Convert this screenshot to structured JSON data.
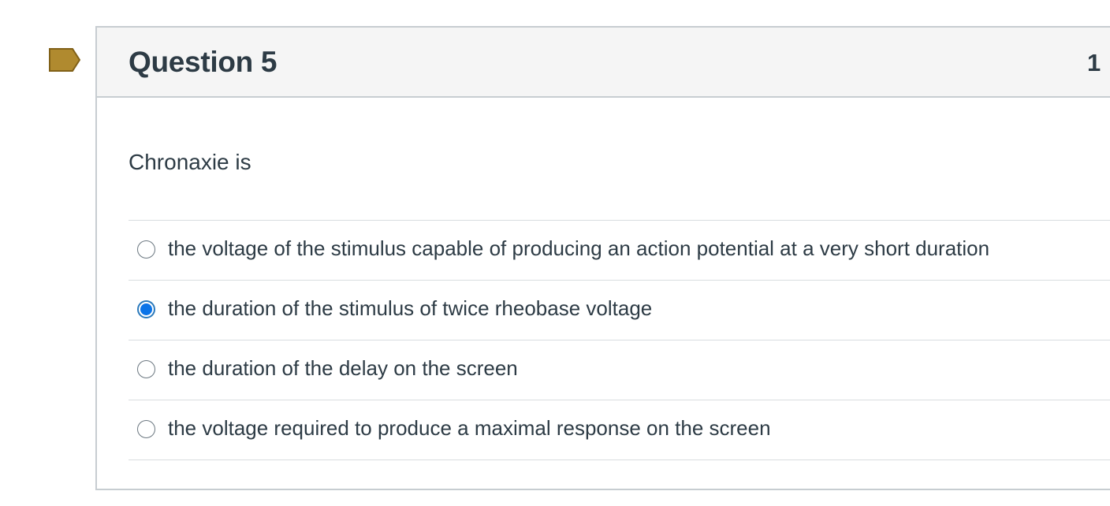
{
  "question": {
    "title": "Question 5",
    "points": "1",
    "text": "Chronaxie is",
    "flag_color": "#b08a2f"
  },
  "answers": [
    {
      "label": "the voltage of the stimulus capable of producing an action potential at a very short duration",
      "selected": false
    },
    {
      "label": "the duration of the stimulus of twice rheobase voltage",
      "selected": true
    },
    {
      "label": "the duration of the delay on the screen",
      "selected": false
    },
    {
      "label": "the voltage required to produce a maximal response on the screen",
      "selected": false
    }
  ],
  "colors": {
    "selected_radio": "#0b74e8",
    "header_background": "#f5f5f5",
    "border": "#c7cdd1",
    "text": "#2d3b45"
  }
}
